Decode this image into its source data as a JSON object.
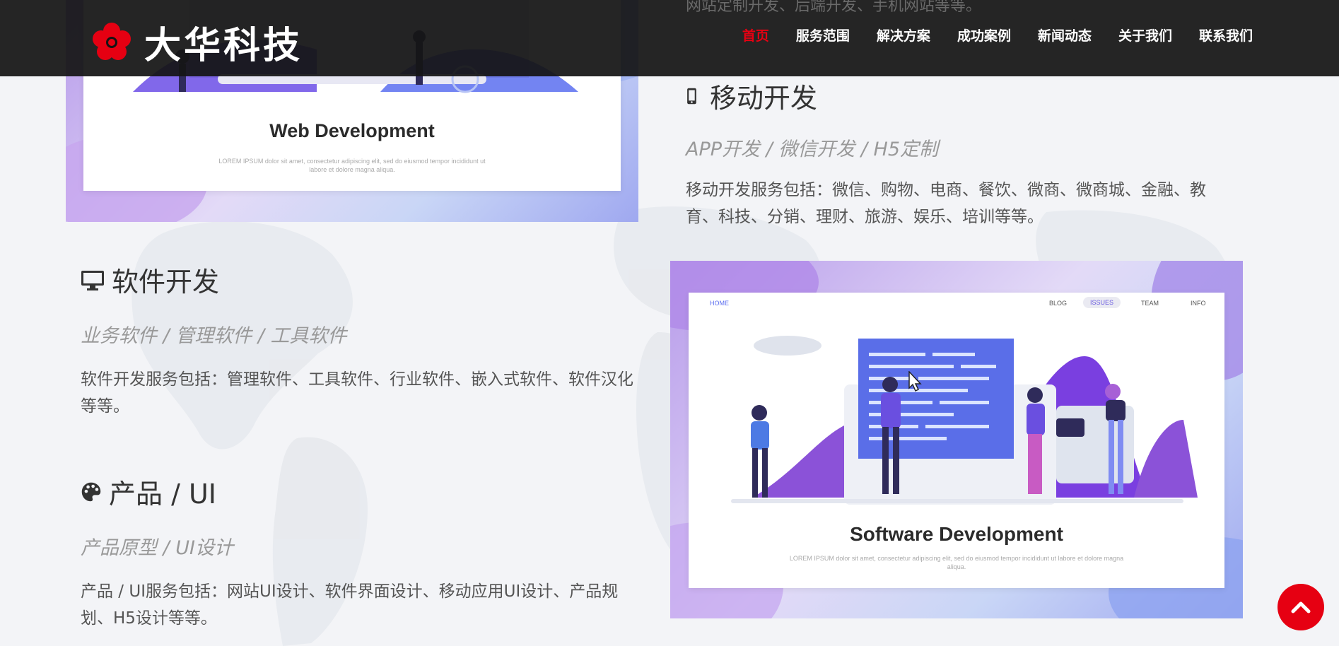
{
  "header": {
    "logo_text": "大华科技",
    "partial_text": "网站定制开发、后端开发、手机网站等等。",
    "nav": [
      {
        "label": "首页",
        "active": true
      },
      {
        "label": "服务范围",
        "active": false
      },
      {
        "label": "解决方案",
        "active": false
      },
      {
        "label": "成功案例",
        "active": false
      },
      {
        "label": "新闻动态",
        "active": false
      },
      {
        "label": "关于我们",
        "active": false
      },
      {
        "label": "联系我们",
        "active": false
      }
    ]
  },
  "cards": {
    "web": {
      "title": "Web Development",
      "lorem": "LOREM IPSUM dolor sit amet, consectetur adipiscing elit, sed do eiusmod tempor incididunt ut labore et dolore magna aliqua."
    },
    "software": {
      "title": "Software Development",
      "lorem": "LOREM IPSUM dolor sit amet, consectetur adipiscing elit, sed do eiusmod tempor incididunt ut labore et dolore magna aliqua.",
      "nav": [
        "HOME",
        "BLOG",
        "ISSUES",
        "TEAM",
        "INFO"
      ]
    }
  },
  "sections": {
    "mobile": {
      "title": "移动开发",
      "subtitle": "APP开发 / 微信开发 / H5定制",
      "desc": "移动开发服务包括：微信、购物、电商、餐饮、微商、微商城、金融、教育、科技、分销、理财、旅游、娱乐、培训等等。",
      "icon": "mobile-icon"
    },
    "software": {
      "title": "软件开发",
      "subtitle": "业务软件 / 管理软件 / 工具软件",
      "desc": "软件开发服务包括：管理软件、工具软件、行业软件、嵌入式软件、软件汉化等等。",
      "icon": "desktop-icon"
    },
    "ui": {
      "title": "产品 / UI",
      "subtitle": "产品原型 / UI设计",
      "desc": "产品 / UI服务包括：网站UI设计、软件界面设计、移动应用UI设计、产品规划、H5设计等等。",
      "icon": "palette-icon"
    }
  },
  "colors": {
    "accent": "#e60012",
    "header_bg": "#141414"
  }
}
